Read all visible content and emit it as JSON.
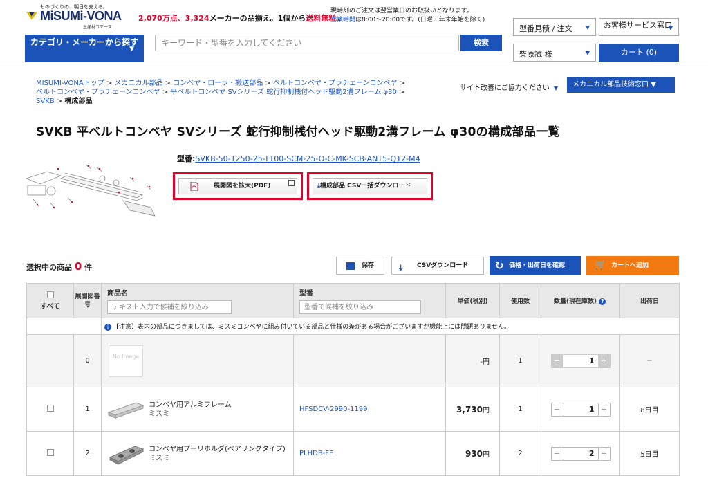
{
  "header": {
    "tagline": "ものづくりの、明日を支える。",
    "brand": "MiSUMi-VONA",
    "brand_sub": "生産材コマース",
    "promo_prefix": "2,070万点、",
    "promo_red2": "3,324",
    "promo_mid": "メーカーの品揃え。1個から",
    "promo_free": "送料無料",
    "promo_end": "。",
    "notice_line1": "現時刻のご注文は翌営業日のお取扱いとなります。",
    "notice_hours_label": "営業時間",
    "notice_line2": "は8:00〜20:00です。(日曜・年末年始を除く)",
    "category_button": "カテゴリ・メーカーから探す",
    "search_placeholder": "キーワード・型番を入力してください",
    "search_button": "検索",
    "quote_menu": "型番見積 / 注文",
    "support_menu": "お客様サービス窓口",
    "user_menu": "柴原誠 様",
    "cart_button": "カート (0)"
  },
  "breadcrumb": {
    "items": [
      "MISUMI-VONAトップ",
      "メカニカル部品",
      "コンベヤ・ローラ・搬送部品",
      "ベルトコンベヤ・プラチェーンコンベヤ",
      "ベルトコンベヤ・プラチェーンコンベヤ",
      "平ベルトコンベヤ SVシリーズ 蛇行抑制桟付ヘッド駆動2溝フレーム φ30",
      "SVKB"
    ],
    "current": "構成部品",
    "separator": ">"
  },
  "feedback_link": "サイト改善にご協力ください",
  "tech_button": "メカニカル部品技術窓口",
  "page_title": "SVKB 平ベルトコンベヤ SVシリーズ 蛇行抑制桟付ヘッド駆動2溝フレーム φ30の構成部品一覧",
  "model": {
    "label": "型番:",
    "number": "SVKB-50-1250-25-T100-SCM-25-O-C-MK-SCB-ANT5-Q12-M4"
  },
  "pdf_button": "展開図を拡大(PDF)",
  "csv_bulk_button": "構成部品 CSV一括ダウンロード",
  "csv_bulk_icon": "⤓",
  "toolbar": {
    "selected_label": "選択中の商品",
    "selected_count": "0",
    "selected_unit": "件",
    "save": "保存",
    "csv": "CSVダウンロード",
    "price": "価格・出荷日を確認",
    "cart": "カートへ追加"
  },
  "table": {
    "headers": {
      "select": "すべて",
      "figno": "展開図番号",
      "name": "商品名",
      "model": "型番",
      "price": "単価(税別)",
      "qty_used": "使用数",
      "quantity": "数量(現在庫数)",
      "ship": "出荷日"
    },
    "name_filter_placeholder": "テキスト入力で候補を絞り込み",
    "model_filter_placeholder": "型番で候補を絞り込み",
    "notice": "【注意】表内の部品につきましては、ミスミコンベヤに組み付いている部品と仕様の差がある場合がございますが機能上には問題ありません。",
    "rows": [
      {
        "fig": "0",
        "noimage": "No Image",
        "name": "",
        "maker": "",
        "model": "",
        "price": "-円",
        "used": "1",
        "qty": "1",
        "ship": "−"
      },
      {
        "fig": "1",
        "name": "コンベヤ用アルミフレーム",
        "maker": "ミスミ",
        "model": "HFSDCV-2990-1199",
        "price": "3,730",
        "price_unit": "円",
        "used": "1",
        "qty": "1",
        "ship": "8日目"
      },
      {
        "fig": "2",
        "name": "コンベヤ用プーリホルダ(ベアリングタイプ)",
        "maker": "ミスミ",
        "model": "PLHDB-FE",
        "price": "930",
        "price_unit": "円",
        "used": "2",
        "qty": "2",
        "ship": "5日目"
      }
    ]
  },
  "colors": {
    "accent": "#1b53b8",
    "red": "#e4002b",
    "orange": "#f27a10"
  }
}
